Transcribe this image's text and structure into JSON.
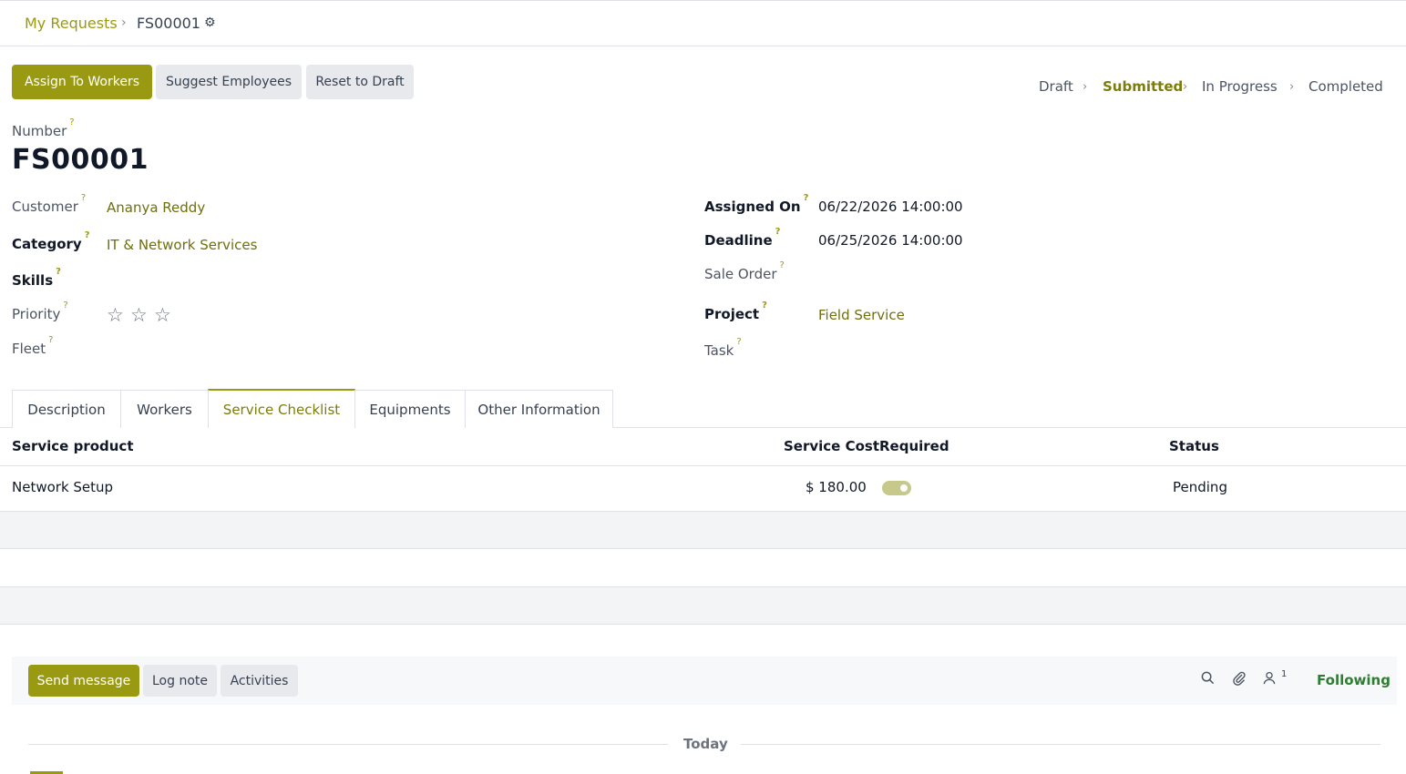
{
  "breadcrumb": {
    "parent": "My Requests",
    "separator": "›",
    "current": "FS00001"
  },
  "actions": {
    "assign": "Assign To Workers",
    "suggest": "Suggest Employees",
    "reset": "Reset to Draft"
  },
  "statusbar": {
    "steps": [
      "Draft",
      "Submitted",
      "In Progress",
      "Completed"
    ],
    "active": "Submitted"
  },
  "form": {
    "number_label": "Number",
    "number_value": "FS00001",
    "help_mark": "?",
    "customer_label": "Customer",
    "customer_value": "Ananya Reddy",
    "category_label": "Category",
    "category_value": "IT & Network Services",
    "skills_label": "Skills",
    "priority_label": "Priority",
    "priority_stars": 0,
    "fleet_label": "Fleet",
    "assigned_on_label": "Assigned On",
    "assigned_on_value": "06/22/2026 14:00:00",
    "deadline_label": "Deadline",
    "deadline_value": "06/25/2026 14:00:00",
    "sale_order_label": "Sale Order",
    "project_label": "Project",
    "project_value": "Field Service",
    "task_label": "Task"
  },
  "tabs": [
    "Description",
    "Workers",
    "Service Checklist",
    "Equipments",
    "Other Information"
  ],
  "active_tab": "Service Checklist",
  "checklist": {
    "headers": {
      "product": "Service product",
      "cost": "Service Cost",
      "required": "Required",
      "status": "Status"
    },
    "rows": [
      {
        "product": "Network Setup",
        "cost": "$ 180.00",
        "required": true,
        "status": "Pending"
      }
    ]
  },
  "chatter": {
    "send_message": "Send message",
    "log_note": "Log note",
    "activities": "Activities",
    "followers_count": "1",
    "following": "Following",
    "icons": [
      "search-icon",
      "paperclip-icon",
      "user-icon"
    ]
  },
  "timeline": {
    "divider": "Today"
  },
  "colors": {
    "brand": "#9a9a12",
    "active_text": "#7c7c0a",
    "following": "#2e7d32"
  }
}
